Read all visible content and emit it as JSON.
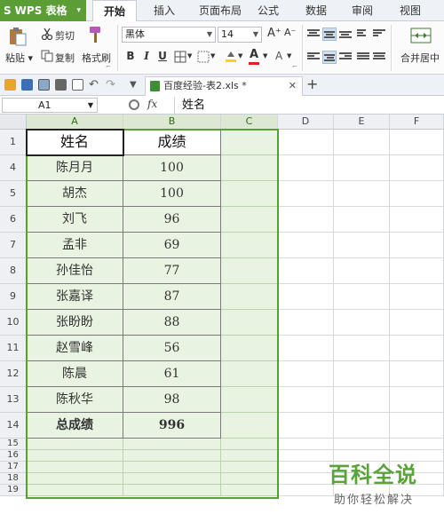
{
  "app": {
    "name": "WPS 表格"
  },
  "menu": {
    "tabs": [
      "开始",
      "插入",
      "页面布局",
      "公式",
      "数据",
      "审阅",
      "视图"
    ],
    "active": "开始"
  },
  "ribbon": {
    "paste_label": "粘贴",
    "cut_label": "剪切",
    "copy_label": "复制",
    "format_painter_label": "格式刷",
    "font_name": "黑体",
    "font_size": "14",
    "grow_font": "A⁺",
    "shrink_font": "A⁻",
    "bold": "B",
    "italic": "I",
    "underline": "U",
    "merge_label": "合并居中"
  },
  "document": {
    "tab_title": "百度经验-表2.xls *"
  },
  "formula_bar": {
    "cell_ref": "A1",
    "fx_label": "fx",
    "content": "姓名"
  },
  "columns": [
    "A",
    "B",
    "C",
    "D",
    "E",
    "F"
  ],
  "rows": [
    "1",
    "4",
    "5",
    "6",
    "7",
    "8",
    "9",
    "10",
    "11",
    "12",
    "13",
    "14",
    "15",
    "16",
    "17",
    "18",
    "19"
  ],
  "table": {
    "header": [
      "姓名",
      "成绩"
    ],
    "records": [
      [
        "陈月月",
        "100"
      ],
      [
        "胡杰",
        "100"
      ],
      [
        "刘飞",
        "96"
      ],
      [
        "孟非",
        "69"
      ],
      [
        "孙佳怡",
        "77"
      ],
      [
        "张嘉译",
        "87"
      ],
      [
        "张盼盼",
        "88"
      ],
      [
        "赵雪峰",
        "56"
      ],
      [
        "陈晨",
        "61"
      ],
      [
        "陈秋华",
        "98"
      ]
    ],
    "total": [
      "总成绩",
      "996"
    ]
  },
  "watermark": {
    "title": "百科全说",
    "subtitle": "助你轻松解决"
  },
  "colors": {
    "accent": "#5a9e35",
    "selection": "#e8f4e1"
  }
}
